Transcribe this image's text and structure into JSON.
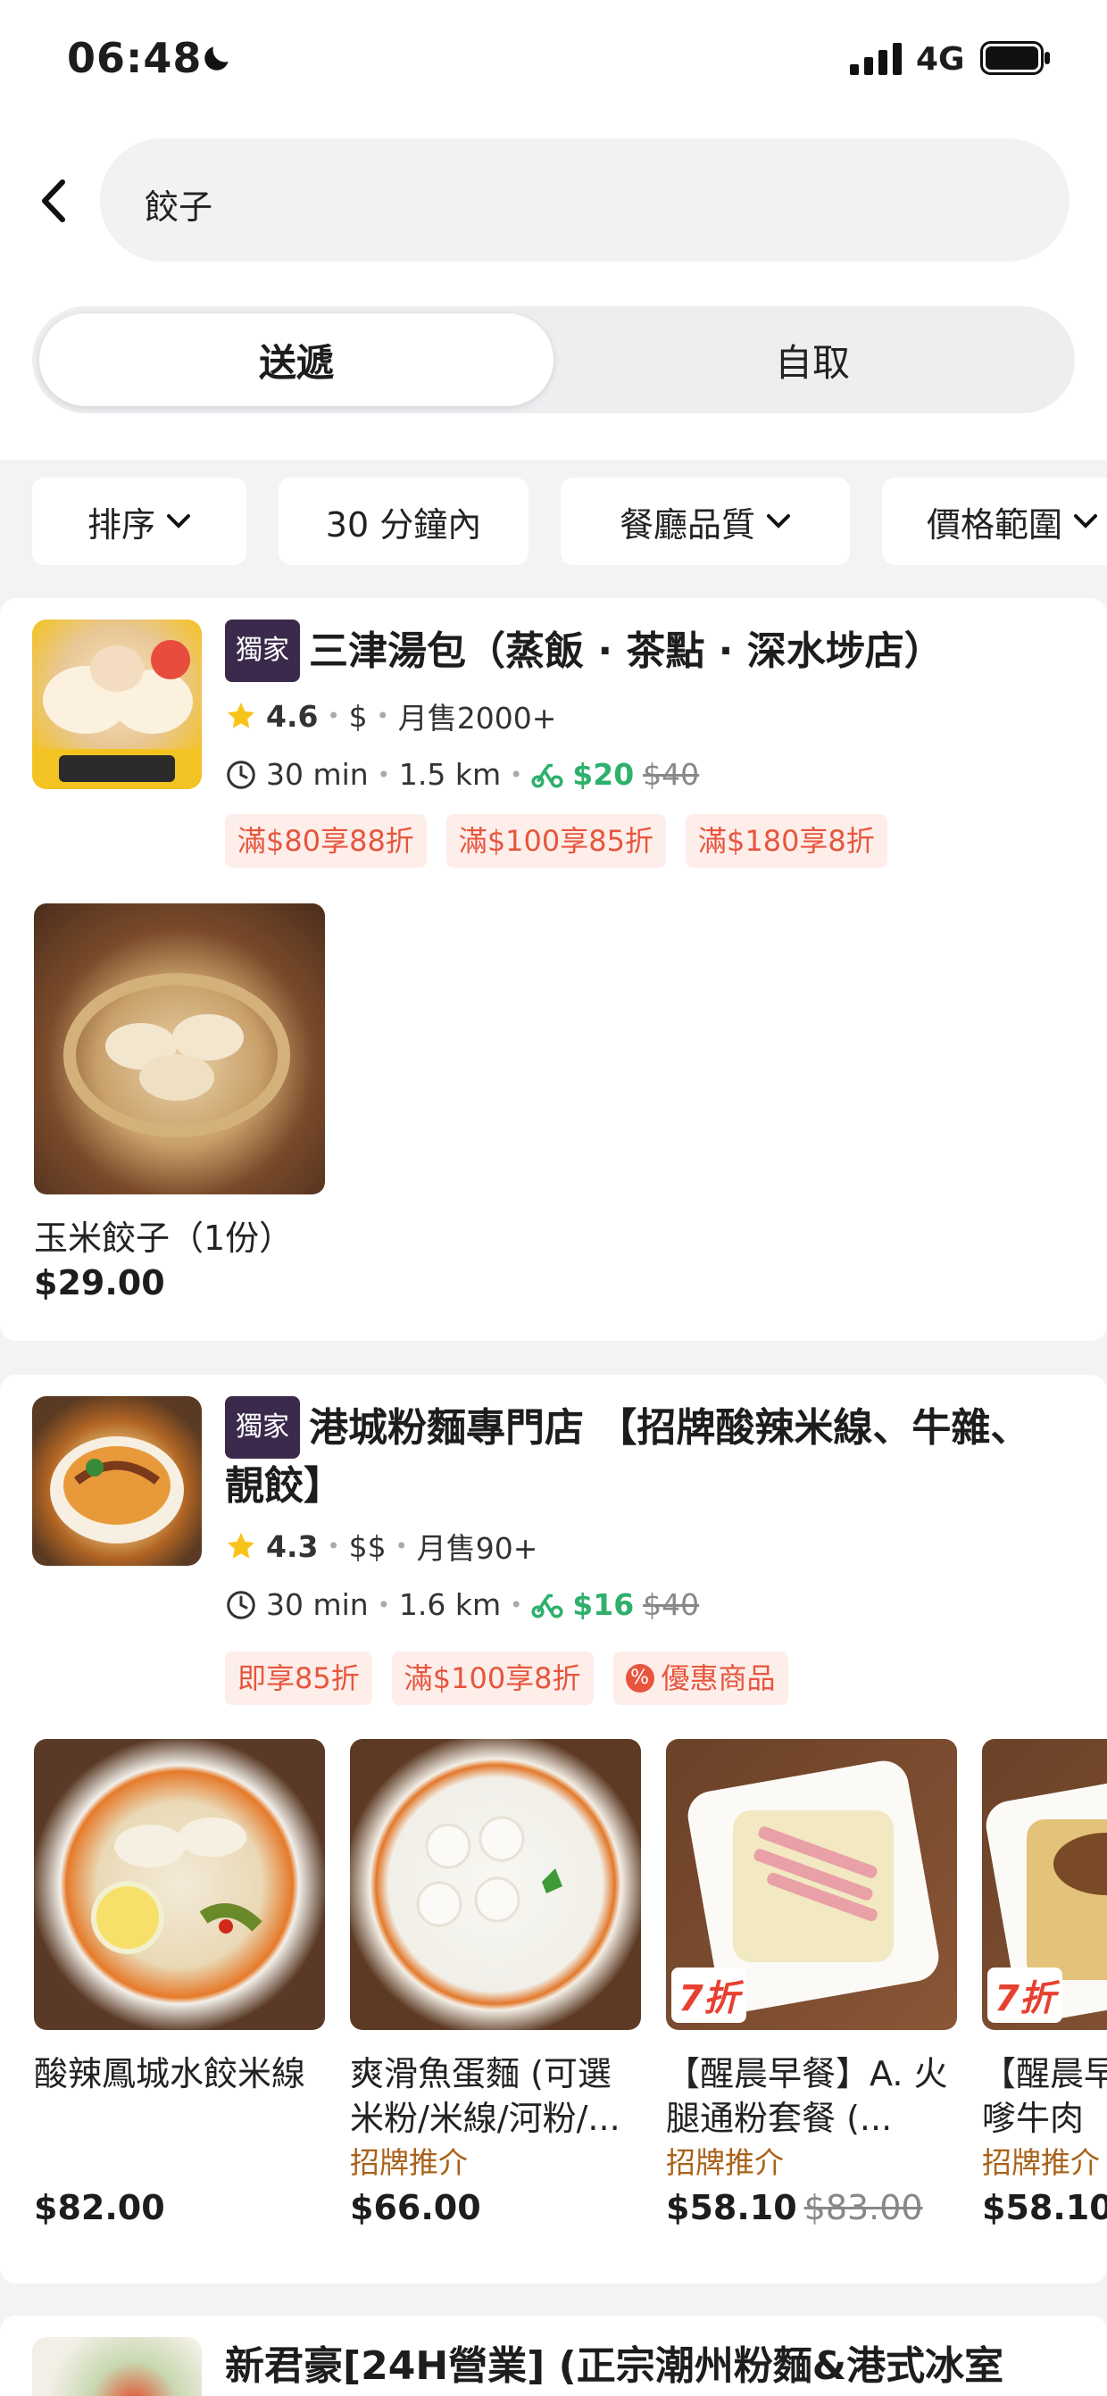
{
  "status": {
    "time": "06:48",
    "network": "4G"
  },
  "search": {
    "query": "餃子"
  },
  "tabs": [
    {
      "label": "送遞",
      "active": true
    },
    {
      "label": "自取",
      "active": false
    }
  ],
  "filters": [
    {
      "label": "排序",
      "dropdown": true
    },
    {
      "label": "30 分鐘內",
      "dropdown": false
    },
    {
      "label": "餐廳品質",
      "dropdown": true
    },
    {
      "label": "價格範圍",
      "dropdown": true
    }
  ],
  "restaurants": [
    {
      "badge": "獨家",
      "name": "三津湯包（蒸飯 · 茶點 · 深水埗店）",
      "rating": "4.6",
      "price_level": "$",
      "sales": "月售2000+",
      "time": "30 min",
      "distance": "1.5 km",
      "delivery_fee": "$20",
      "delivery_fee_original": "$40",
      "promos": [
        "滿$80享88折",
        "滿$100享85折",
        "滿$180享8折"
      ],
      "dishes": [
        {
          "name": "玉米餃子（1份）",
          "price": "$29.00"
        }
      ]
    },
    {
      "badge": "獨家",
      "name": "港城粉麵專門店 【招牌酸辣米線、牛雜、靚餃】",
      "rating": "4.3",
      "price_level": "$$",
      "sales": "月售90+",
      "time": "30 min",
      "distance": "1.6 km",
      "delivery_fee": "$16",
      "delivery_fee_original": "$40",
      "promos": [
        "即享85折",
        "滿$100享8折",
        "優惠商品"
      ],
      "dishes": [
        {
          "name": "酸辣鳳城水餃米線",
          "tag": "",
          "price": "$82.00",
          "original": ""
        },
        {
          "name": "爽滑魚蛋麵 (可選米粉/米線/河粉/...",
          "tag": "招牌推介",
          "price": "$66.00",
          "original": ""
        },
        {
          "name": "【醒晨早餐】A. 火腿通粉套餐 (...",
          "tag": "招牌推介",
          "price": "$58.10",
          "original": "$83.00",
          "discount": "7折"
        },
        {
          "name": "【醒晨早餐】B. 沙嗲牛肉",
          "tag": "招牌推介",
          "price": "$58.10",
          "original": "",
          "discount": "7折"
        }
      ]
    },
    {
      "name": "新君豪[24H營業] (正宗潮州粉麵&港式冰室"
    }
  ],
  "colors": {
    "accent_green": "#2fb06c",
    "promo_red": "#e8553d",
    "badge_bg": "#3b2a4c",
    "rec_brown": "#a9621a"
  }
}
